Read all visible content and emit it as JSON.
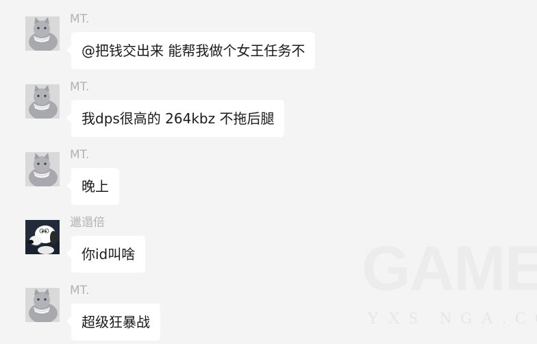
{
  "messages": [
    {
      "sender": "MT.",
      "avatar": "cat-avatar",
      "text": "@把钱交出来 能帮我做个女王任务不"
    },
    {
      "sender": "MT.",
      "avatar": "cat-avatar",
      "text": "我dps很高的 264kbz 不拖后腿"
    },
    {
      "sender": "MT.",
      "avatar": "cat-avatar",
      "text": "晚上"
    },
    {
      "sender": "邋遢倍",
      "avatar": "cartoon-dog-avatar",
      "text": "你id叫啥"
    },
    {
      "sender": "MT.",
      "avatar": "cat-avatar",
      "text": "超级狂暴战"
    }
  ],
  "watermark": {
    "main": "GAME",
    "sub": "YXS NGA.CO"
  },
  "colors": {
    "background": "#f4f4f4",
    "bubble": "#ffffff",
    "sender_name": "#b2b2b2",
    "text": "#1a1a1a"
  }
}
